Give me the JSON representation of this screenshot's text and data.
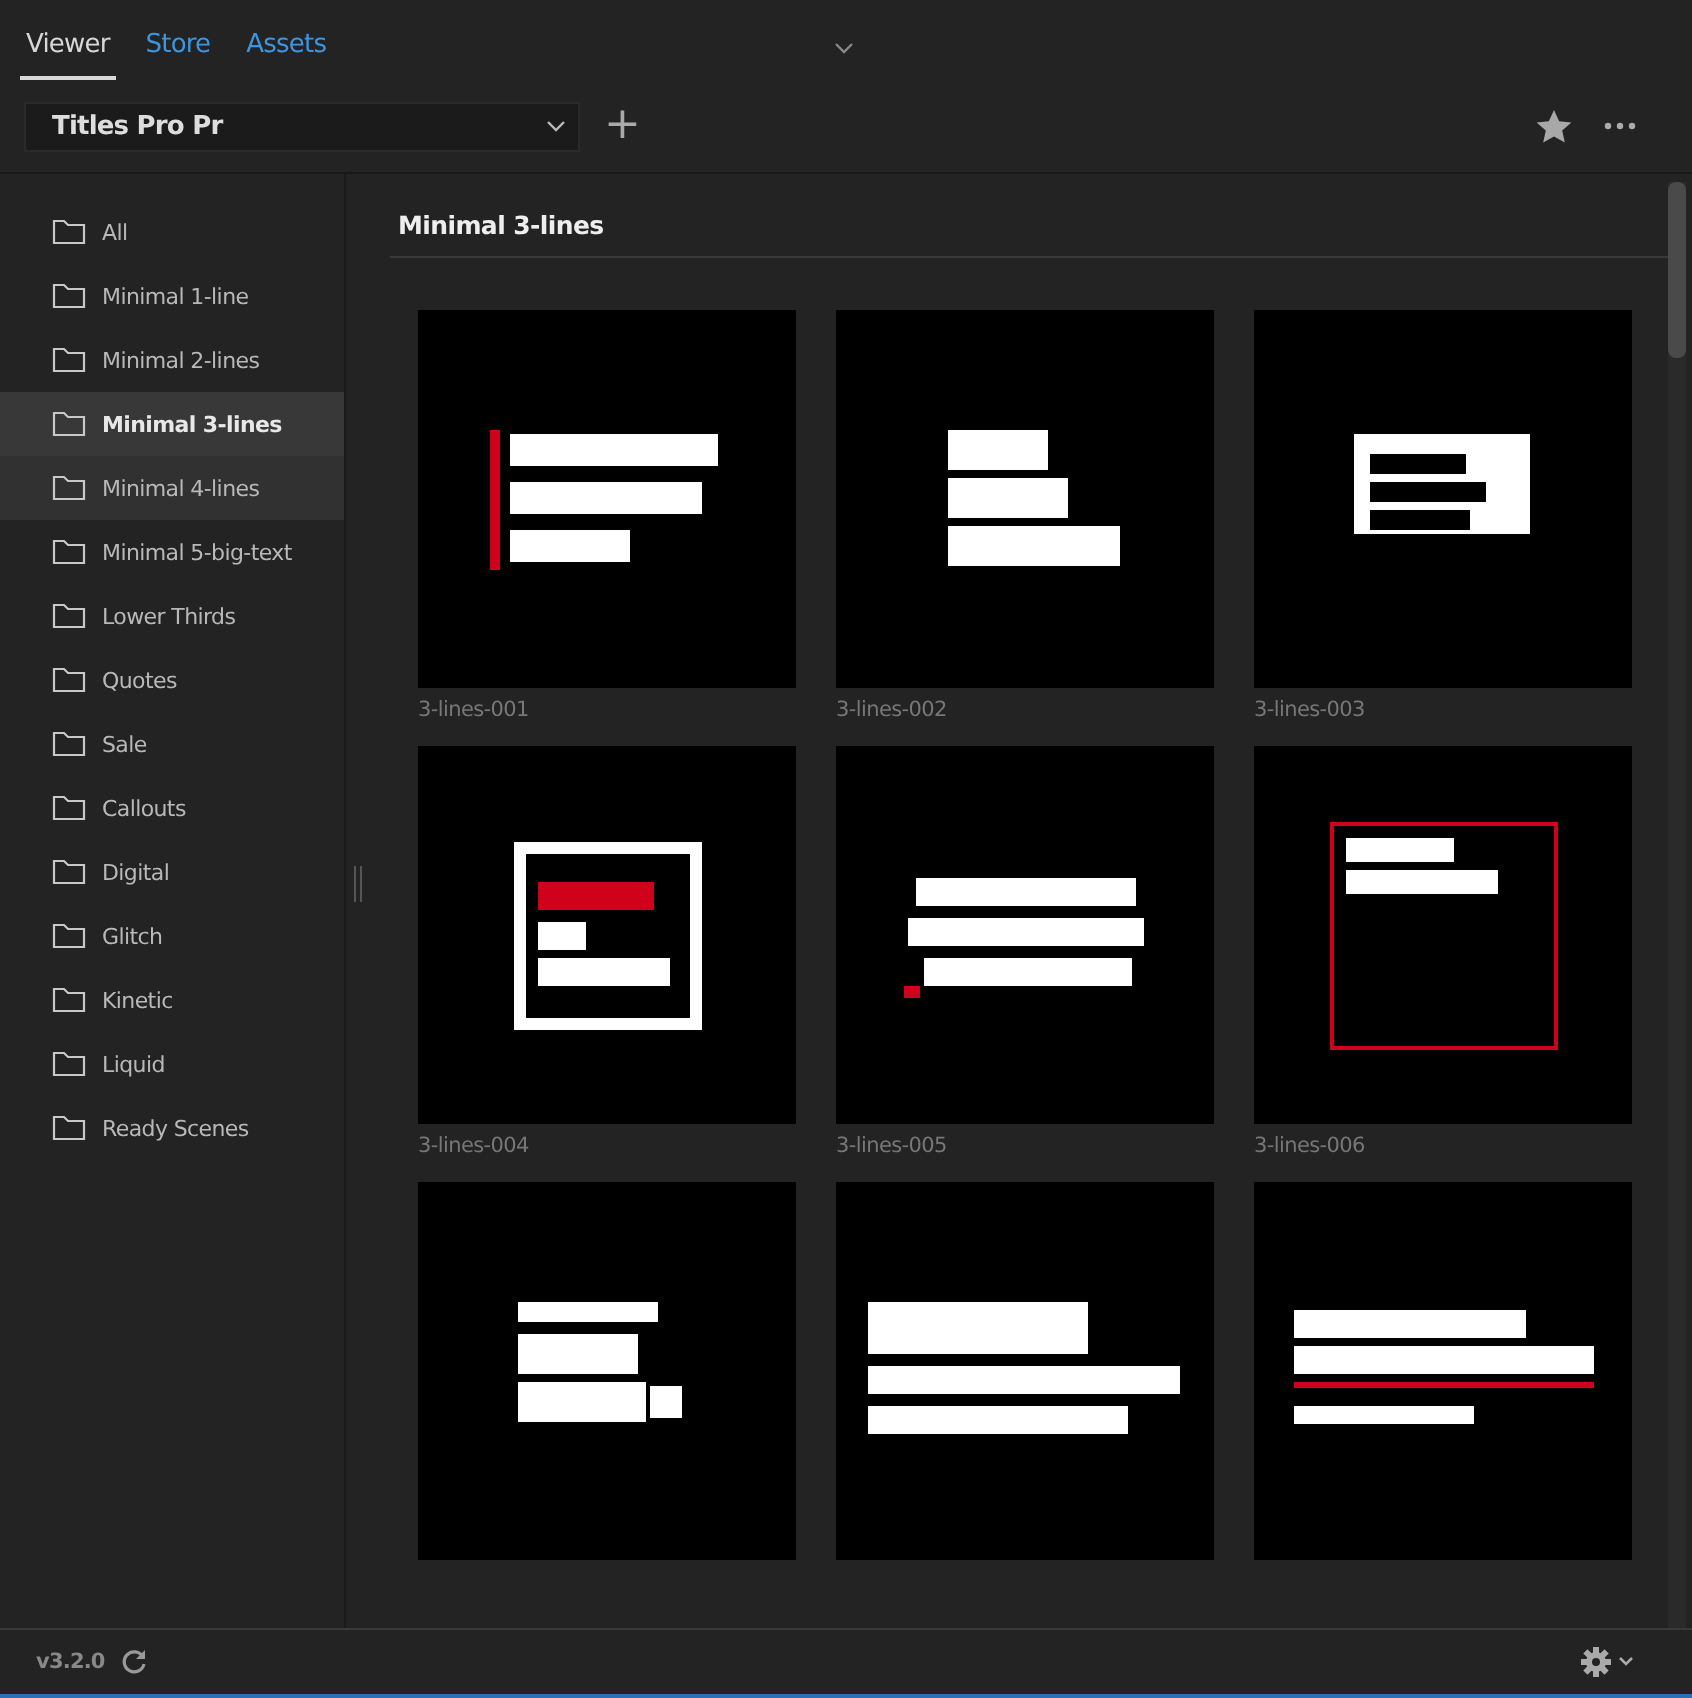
{
  "tabs": [
    {
      "label": "Viewer",
      "selected": true
    },
    {
      "label": "Store",
      "selected": false
    },
    {
      "label": "Assets",
      "selected": false
    }
  ],
  "toolbar": {
    "dropdown": "Titles Pro Pr",
    "add_button": "+"
  },
  "sidebar": {
    "items": [
      {
        "label": "All",
        "selected": false,
        "hovered": false
      },
      {
        "label": "Minimal 1-line",
        "selected": false,
        "hovered": false
      },
      {
        "label": "Minimal 2-lines",
        "selected": false,
        "hovered": false
      },
      {
        "label": "Minimal 3-lines",
        "selected": true,
        "hovered": false
      },
      {
        "label": "Minimal 4-lines",
        "selected": false,
        "hovered": true
      },
      {
        "label": "Minimal 5-big-text",
        "selected": false,
        "hovered": false
      },
      {
        "label": "Lower Thirds",
        "selected": false,
        "hovered": false
      },
      {
        "label": "Quotes",
        "selected": false,
        "hovered": false
      },
      {
        "label": "Sale",
        "selected": false,
        "hovered": false
      },
      {
        "label": "Callouts",
        "selected": false,
        "hovered": false
      },
      {
        "label": "Digital",
        "selected": false,
        "hovered": false
      },
      {
        "label": "Glitch",
        "selected": false,
        "hovered": false
      },
      {
        "label": "Kinetic",
        "selected": false,
        "hovered": false
      },
      {
        "label": "Liquid",
        "selected": false,
        "hovered": false
      },
      {
        "label": "Ready Scenes",
        "selected": false,
        "hovered": false
      }
    ]
  },
  "section": {
    "title": "Minimal 3-lines"
  },
  "templates": [
    {
      "name": "3-lines-001",
      "kind": "picture"
    },
    {
      "name": "3-lines-002",
      "kind": "picture"
    },
    {
      "name": "3-lines-003",
      "kind": "picture"
    },
    {
      "name": "3-lines-004",
      "kind": "picture"
    },
    {
      "name": "3-lines-005",
      "kind": "picture"
    },
    {
      "name": "3-lines-006",
      "kind": "picture"
    },
    {
      "kind": "picture"
    },
    {
      "kind": "picture"
    },
    {
      "kind": "picture"
    }
  ],
  "footer": {
    "version": "v3.2.0"
  }
}
